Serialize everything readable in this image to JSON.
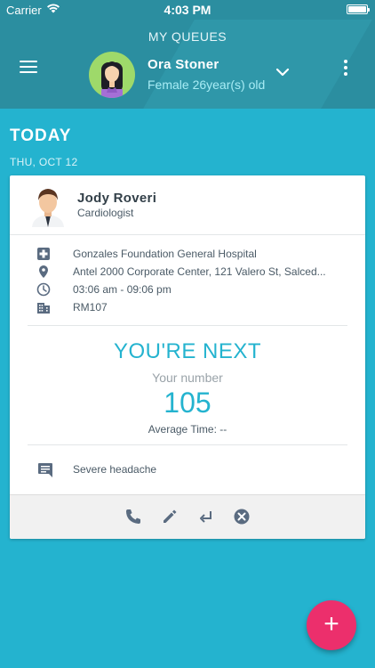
{
  "status_bar": {
    "carrier": "Carrier",
    "time": "4:03 PM"
  },
  "header": {
    "title": "MY QUEUES",
    "user": {
      "name": "Ora Stoner",
      "details": "Female 26year(s) old"
    }
  },
  "section": {
    "title": "TODAY",
    "date": "THU, OCT 12"
  },
  "card": {
    "doctor": {
      "name": "Jody Roveri",
      "specialty": "Cardiologist"
    },
    "info": [
      {
        "icon": "hospital-cross-icon",
        "text": "Gonzales Foundation General Hospital"
      },
      {
        "icon": "location-pin-icon",
        "text": "Antel 2000 Corporate Center, 121 Valero St, Salced..."
      },
      {
        "icon": "clock-icon",
        "text": "03:06 am - 09:06 pm"
      },
      {
        "icon": "building-icon",
        "text": "RM107"
      }
    ],
    "queue": {
      "status": "YOU'RE NEXT",
      "number_label": "Your number",
      "number": "105",
      "average_time": "Average Time: --"
    },
    "note": {
      "icon": "message-icon",
      "text": "Severe headache"
    },
    "actions": [
      "phone-icon",
      "edit-icon",
      "return-icon",
      "cancel-icon"
    ]
  },
  "fab": {
    "label": "+"
  },
  "colors": {
    "header": "#2b8ea0",
    "background": "#24b3cf",
    "accent": "#24b3cf",
    "fab": "#ec2f6c",
    "icon": "#5a6b80"
  }
}
